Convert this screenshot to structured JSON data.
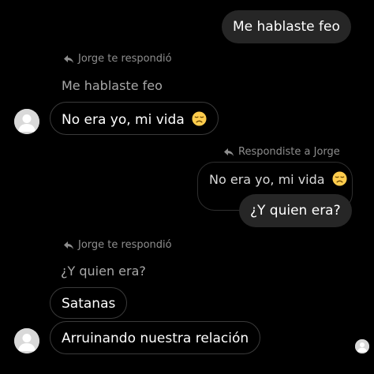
{
  "messages": {
    "m1": "Me hablaste feo",
    "reply1_label": "Jorge te respondió",
    "reply1_quote": "Me hablaste feo",
    "m2": "No era yo, mi vida",
    "reply2_label": "Respondiste a Jorge",
    "reply2_quote": "No era yo, mi vida",
    "m3": "¿Y quien era?",
    "reply3_label": "Jorge te respondió",
    "reply3_quote": "¿Y quien era?",
    "m4": "Satanas",
    "m5": "Arruinando nuestra relación"
  },
  "icons": {
    "reply": "reply-arrow-icon",
    "emoji": "disappointed-face-emoji",
    "avatar": "default-avatar-icon"
  },
  "colors": {
    "background": "#000000",
    "sent_bubble": "#262626",
    "bubble_outline": "#3a3a3a",
    "secondary_text": "#8e8e8e"
  }
}
